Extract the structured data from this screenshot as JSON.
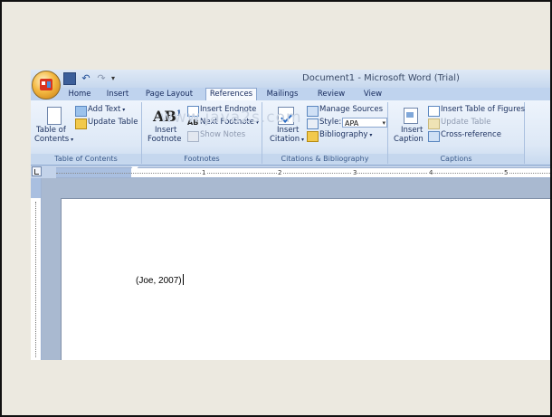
{
  "window": {
    "title": "Document1 - Microsoft Word (Trial)"
  },
  "quick_access": {
    "icons": [
      "save-icon",
      "undo-icon",
      "redo-icon",
      "customize-icon"
    ]
  },
  "tabs": [
    "Home",
    "Insert",
    "Page Layout",
    "References",
    "Mailings",
    "Review",
    "View"
  ],
  "active_tab": "References",
  "ribbon": {
    "toc": {
      "group": "Table of Contents",
      "big_line1": "Table of",
      "big_line2": "Contents",
      "add_text": "Add Text",
      "update_table": "Update Table"
    },
    "footnotes": {
      "group": "Footnotes",
      "big_line1": "Insert",
      "big_line2": "Footnote",
      "insert_endnote": "Insert Endnote",
      "next_footnote": "Next Footnote",
      "show_notes": "Show Notes"
    },
    "citations": {
      "group": "Citations & Bibliography",
      "big_line1": "Insert",
      "big_line2": "Citation",
      "manage_sources": "Manage Sources",
      "style_label": "Style:",
      "style_value": "APA",
      "bibliography": "Bibliography"
    },
    "captions": {
      "group": "Captions",
      "big_line1": "Insert",
      "big_line2": "Caption",
      "insert_table_of_figures": "Insert Table of Figures",
      "update_table": "Update Table",
      "cross_reference": "Cross-reference"
    }
  },
  "ruler": {
    "numbers": [
      "1",
      "2",
      "3",
      "4",
      "5"
    ]
  },
  "document": {
    "text": "(Joe, 2007)"
  },
  "watermark": "www.java2s.com",
  "colors": {
    "accent": "#1f4d96",
    "ribbon": "#dde8f6",
    "workspace": "#a9b9d0"
  }
}
